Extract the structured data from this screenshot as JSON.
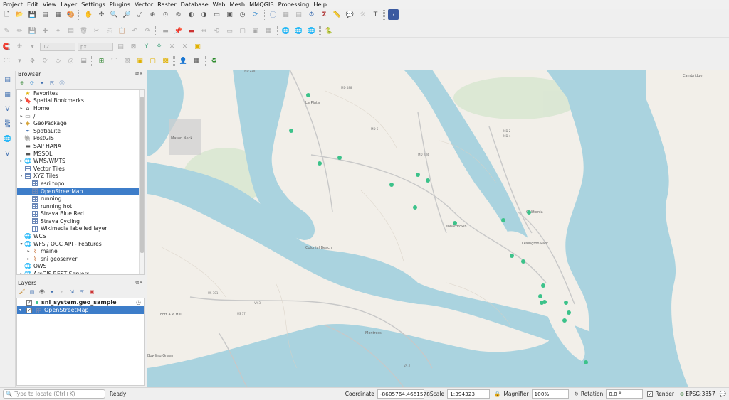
{
  "menu": [
    "Project",
    "Edit",
    "View",
    "Layer",
    "Settings",
    "Plugins",
    "Vector",
    "Raster",
    "Database",
    "Web",
    "Mesh",
    "MMQGIS",
    "Processing",
    "Help"
  ],
  "digitize_toolbar": {
    "size_value": "12",
    "unit_value": "px"
  },
  "browser": {
    "title": "Browser",
    "items": [
      {
        "label": "Favorites",
        "icon": "star-icon",
        "level": 0,
        "arrow": ""
      },
      {
        "label": "Spatial Bookmarks",
        "icon": "bookmark-icon",
        "level": 0,
        "arrow": "▸"
      },
      {
        "label": "Home",
        "icon": "home-icon",
        "level": 0,
        "arrow": "▸"
      },
      {
        "label": "/",
        "icon": "folder-icon",
        "level": 0,
        "arrow": "▸"
      },
      {
        "label": "GeoPackage",
        "icon": "geopackage-icon",
        "level": 0,
        "arrow": "▸"
      },
      {
        "label": "SpatiaLite",
        "icon": "spatialite-icon",
        "level": 0,
        "arrow": ""
      },
      {
        "label": "PostGIS",
        "icon": "postgis-icon",
        "level": 0,
        "arrow": ""
      },
      {
        "label": "SAP HANA",
        "icon": "database-icon",
        "level": 0,
        "arrow": ""
      },
      {
        "label": "MSSQL",
        "icon": "database-icon",
        "level": 0,
        "arrow": ""
      },
      {
        "label": "WMS/WMTS",
        "icon": "globe-icon",
        "level": 0,
        "arrow": "▸"
      },
      {
        "label": "Vector Tiles",
        "icon": "grid-icon",
        "level": 0,
        "arrow": ""
      },
      {
        "label": "XYZ Tiles",
        "icon": "grid-icon",
        "level": 0,
        "arrow": "▾"
      },
      {
        "label": "esri topo",
        "icon": "grid-icon",
        "level": 1,
        "arrow": ""
      },
      {
        "label": "OpenStreetMap",
        "icon": "grid-icon",
        "level": 1,
        "arrow": "",
        "selected": true
      },
      {
        "label": "running",
        "icon": "grid-icon",
        "level": 1,
        "arrow": ""
      },
      {
        "label": "running hot",
        "icon": "grid-icon",
        "level": 1,
        "arrow": ""
      },
      {
        "label": "Strava Blue Red",
        "icon": "grid-icon",
        "level": 1,
        "arrow": ""
      },
      {
        "label": "Strava Cycling",
        "icon": "grid-icon",
        "level": 1,
        "arrow": ""
      },
      {
        "label": "Wikimedia labelled layer",
        "icon": "grid-icon",
        "level": 1,
        "arrow": ""
      },
      {
        "label": "WCS",
        "icon": "globe-icon",
        "level": 0,
        "arrow": ""
      },
      {
        "label": "WFS / OGC API - Features",
        "icon": "globe-icon",
        "level": 0,
        "arrow": "▾"
      },
      {
        "label": "maine",
        "icon": "wfs-icon",
        "level": 1,
        "arrow": "▸"
      },
      {
        "label": "sni geoserver",
        "icon": "wfs-icon",
        "level": 1,
        "arrow": "▸"
      },
      {
        "label": "OWS",
        "icon": "globe-icon",
        "level": 0,
        "arrow": ""
      },
      {
        "label": "ArcGIS REST Servers",
        "icon": "globe-icon",
        "level": 0,
        "arrow": "▸"
      }
    ]
  },
  "layers": {
    "title": "Layers",
    "items": [
      {
        "label": "sni_system.geo_sample",
        "checked": "✓",
        "icon": "point-layer-icon",
        "bold": true,
        "selected": false
      },
      {
        "label": "OpenStreetMap",
        "checked": "✓",
        "icon": "xyz-layer-icon",
        "bold": false,
        "selected": true
      }
    ]
  },
  "map": {
    "place_labels": [
      "La Plata",
      "Mason Neck",
      "Leonardtown",
      "Lexington Park",
      "Colonial Beach",
      "Montross",
      "Fort A.P. Hill",
      "Bowling Green",
      "California",
      "Cambridge"
    ],
    "road_labels": [
      "MD 228",
      "MD 488",
      "MD 6",
      "MD 234",
      "MD 2",
      "MD 4",
      "US 301",
      "VA 3",
      "US 17",
      "VA 3"
    ],
    "point_color": "#3cc28a",
    "water_color": "#aad3df"
  },
  "status": {
    "locate_placeholder": "Type to locate (Ctrl+K)",
    "ready": "Ready",
    "coordinate_label": "Coordinate",
    "coordinate_value": "-8605764,4661578",
    "scale_label": "Scale",
    "scale_value": "1:394323",
    "magnifier_label": "Magnifier",
    "magnifier_value": "100%",
    "rotation_label": "Rotation",
    "rotation_value": "0.0 °",
    "render_label": "Render",
    "crs": "EPSG:3857"
  }
}
